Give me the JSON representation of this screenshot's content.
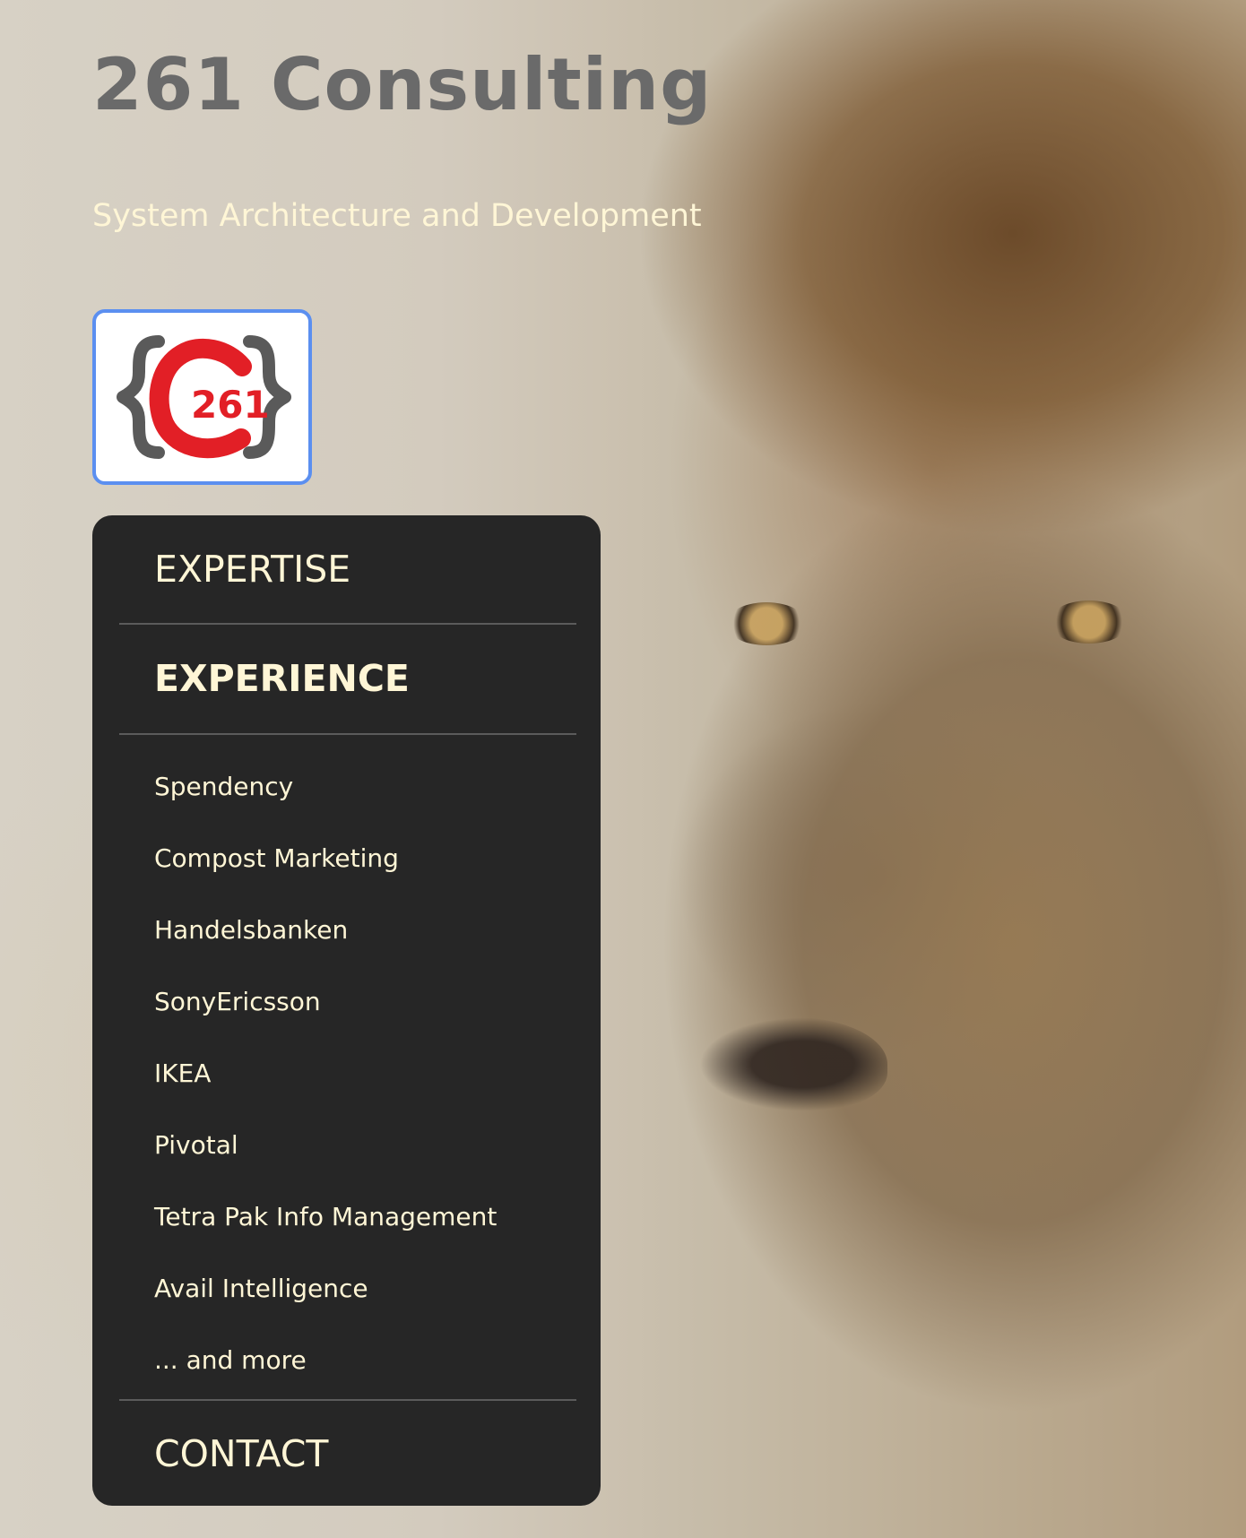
{
  "site": {
    "title": "261 Consulting",
    "subtitle": "System Architecture and Development",
    "logo": {
      "text": "261"
    }
  },
  "nav": {
    "items": [
      {
        "label": "EXPERTISE"
      },
      {
        "label": "EXPERIENCE"
      },
      {
        "label": "CONTACT"
      }
    ],
    "experience_items": [
      {
        "label": "Spendency"
      },
      {
        "label": "Compost Marketing"
      },
      {
        "label": "Handelsbanken"
      },
      {
        "label": "SonyEricsson"
      },
      {
        "label": "IKEA"
      },
      {
        "label": "Pivotal"
      },
      {
        "label": "Tetra Pak Info Management"
      },
      {
        "label": "Avail Intelligence"
      },
      {
        "label": "... and more"
      }
    ]
  },
  "colors": {
    "title_gray": "#6a6a6a",
    "accent_cream": "#fff6d6",
    "nav_background": "#262626",
    "logo_border_blue": "#5b8ff0",
    "logo_red": "#e21f26",
    "logo_brace_gray": "#5a5a5a"
  }
}
